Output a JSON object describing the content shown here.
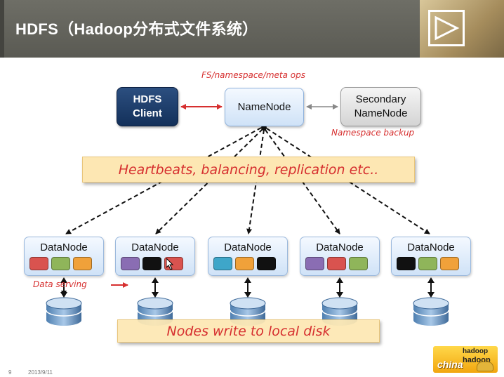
{
  "header": {
    "title": "HDFS（Hadoop分布式文件系统）"
  },
  "nodes": {
    "client": {
      "line1": "HDFS",
      "line2": "Client"
    },
    "namenode": {
      "label": "NameNode"
    },
    "secondary": {
      "line1": "Secondary",
      "line2": "NameNode"
    }
  },
  "annotations": {
    "fs_ops": "FS/namespace/meta ops",
    "namespace_backup": "Namespace backup",
    "data_serving": "Data serving"
  },
  "banners": {
    "heartbeats": "Heartbeats, balancing, replication etc..",
    "local_disk": "Nodes write to local disk"
  },
  "datanodes": [
    {
      "label": "DataNode",
      "blocks": [
        "#d9534f",
        "#8fb55a",
        "#f0a13a"
      ]
    },
    {
      "label": "DataNode",
      "blocks": [
        "#8a6db3",
        "#111111",
        "#d9534f"
      ]
    },
    {
      "label": "DataNode",
      "blocks": [
        "#3ea6c9",
        "#f0a13a",
        "#111111"
      ]
    },
    {
      "label": "DataNode",
      "blocks": [
        "#8a6db3",
        "#d9534f",
        "#8fb55a"
      ]
    },
    {
      "label": "DataNode",
      "blocks": [
        "#111111",
        "#8fb55a",
        "#f0a13a"
      ]
    }
  ],
  "footer": {
    "page_number": "9",
    "date": "2013/9/11"
  },
  "logo": {
    "text_china": "china",
    "text_hadoop": "hadoop",
    "text_hadoop_small": "hadoop"
  },
  "colors": {
    "header_bg": "#5f5f58",
    "annotation_red": "#d62f2f",
    "banner_bg": "#fde7b3",
    "client_blue": "#1c3d6b"
  }
}
